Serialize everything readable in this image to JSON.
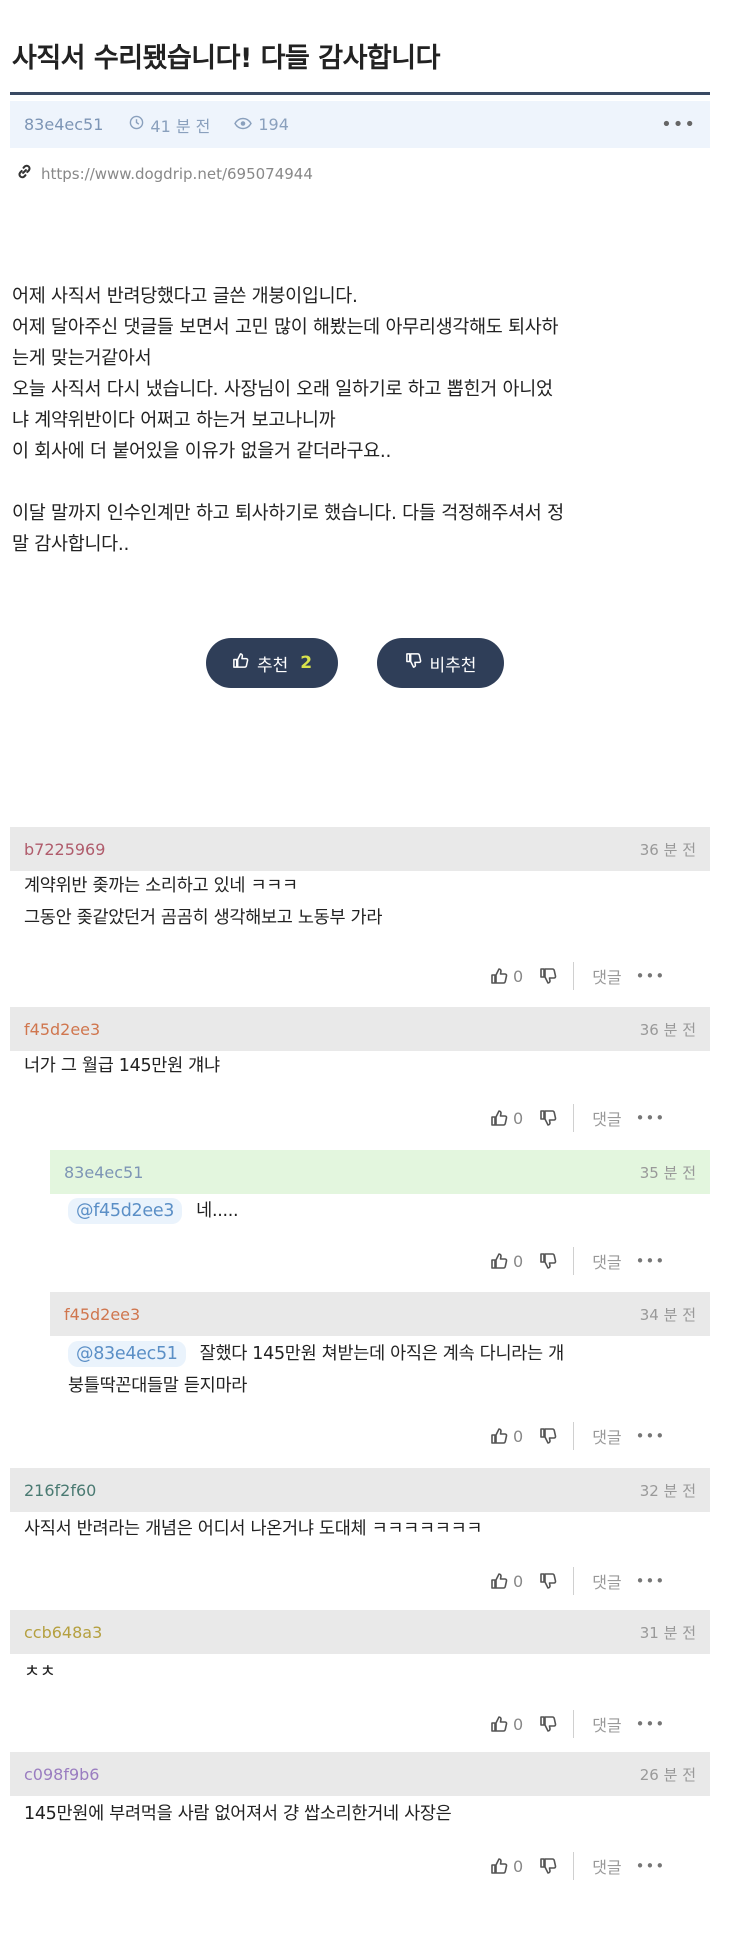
{
  "post": {
    "title": "사직서 수리됐습니다! 다들 감사합니다",
    "author": "83e4ec51",
    "time": "41 분 전",
    "views": "194",
    "more": "•••",
    "url": "https://www.dogdrip.net/695074944",
    "body": [
      "어제 사직서 반려당했다고 글쓴 개붕이입니다.",
      "어제 달아주신 댓글들 보면서 고민 많이 해봤는데 아무리생각해도 퇴사하",
      "는게 맞는거같아서",
      "오늘 사직서 다시 냈습니다. 사장님이 오래 일하기로 하고 뽑힌거 아니었",
      "냐 계약위반이다 어쩌고 하는거 보고나니까",
      "이 회사에 더 붙어있을 이유가 없을거 같더라구요..",
      "",
      "이달 말까지 인수인계만 하고 퇴사하기로 했습니다. 다들 걱정해주셔서 정",
      "말 감사합니다.."
    ],
    "upvote_label": "추천",
    "upvote_count": "2",
    "downvote_label": "비추천"
  },
  "ui": {
    "reply_label": "댓글",
    "dots": "•••",
    "colors": {
      "accent": "#2f3e58",
      "meta_bg": "#eef4fc",
      "comment_bg": "#e9e9e9",
      "own_comment_bg": "#e3f6de"
    }
  },
  "comments": [
    {
      "author": "b7225969",
      "author_color": "#b05c6c",
      "time": "36 분 전",
      "lines": [
        "계약위반 좆까는 소리하고 있네 ㅋㅋㅋ",
        "그동안 좆같았던거 곰곰히 생각해보고 노동부 가라"
      ],
      "likes": "0"
    },
    {
      "author": "f45d2ee3",
      "author_color": "#d0764e",
      "time": "36 분 전",
      "lines": [
        "너가 그 월급 145만원 걔냐"
      ],
      "likes": "0"
    },
    {
      "author": "83e4ec51",
      "author_color": "#7d95b5",
      "time": "35 분 전",
      "mention": "@f45d2ee3",
      "lines": [
        "네....."
      ],
      "likes": "0"
    },
    {
      "author": "f45d2ee3",
      "author_color": "#d0764e",
      "time": "34 분 전",
      "mention": "@83e4ec51",
      "lines": [
        "잘했다 145만원 쳐받는데 아직은 계속 다니라는 개",
        "붕틀딱꼰대들말 듣지마라"
      ],
      "likes": "0"
    },
    {
      "author": "216f2f60",
      "author_color": "#4a7a72",
      "time": "32 분 전",
      "lines": [
        "사직서 반려라는 개념은 어디서 나온거냐 도대체 ㅋㅋㅋㅋㅋㅋㅋ"
      ],
      "likes": "0"
    },
    {
      "author": "ccb648a3",
      "author_color": "#b5a040",
      "time": "31 분 전",
      "lines": [
        "ㅊㅊ"
      ],
      "likes": "0"
    },
    {
      "author": "c098f9b6",
      "author_color": "#9a7dc0",
      "time": "26 분 전",
      "lines": [
        "145만원에 부려먹을 사람 없어져서 걍 쌉소리한거네 사장은"
      ],
      "likes": "0"
    }
  ]
}
